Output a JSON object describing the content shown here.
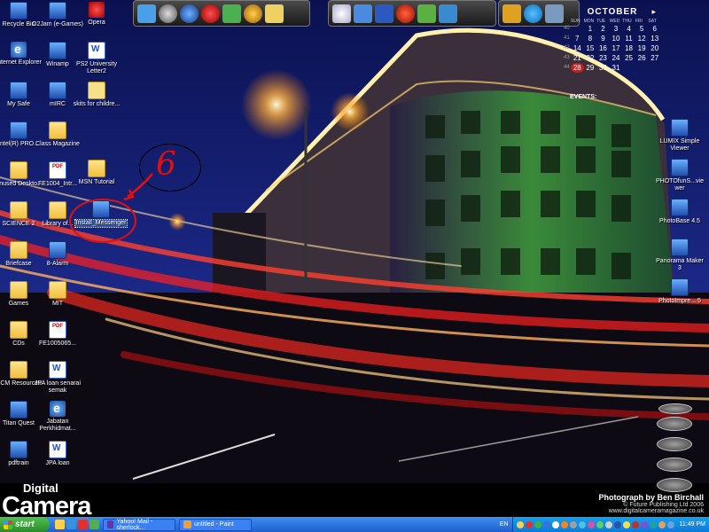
{
  "desktop": {
    "icons_left": [
      {
        "label": "Recycle Bin"
      },
      {
        "label": "Internet Explorer"
      },
      {
        "label": "My Safe"
      },
      {
        "label": "Intel(R) PRO..."
      },
      {
        "label": "Unused Deskto..."
      },
      {
        "label": "SCIENCE 2"
      },
      {
        "label": "Briefcase"
      },
      {
        "label": "Games"
      },
      {
        "label": "CDs"
      },
      {
        "label": "DCM Resources"
      },
      {
        "label": "Titan Quest"
      },
      {
        "label": "pdftrain"
      }
    ],
    "icons_col2": [
      {
        "label": "O2Jam (e-Games)"
      },
      {
        "label": "Winamp"
      },
      {
        "label": "mIRC"
      },
      {
        "label": "Class Magazine"
      },
      {
        "label": "FE1004_Intr..."
      },
      {
        "label": "Library of..."
      },
      {
        "label": "8-Alarm"
      },
      {
        "label": "MIT"
      },
      {
        "label": "FE1005065..."
      },
      {
        "label": "JPA loan senarai semak"
      },
      {
        "label": "Jabatan Perkhidmat..."
      },
      {
        "label": "JPA loan"
      }
    ],
    "icons_col3": [
      {
        "label": "Opera"
      },
      {
        "label": "PS2 University Letter2"
      },
      {
        "label": "skits for childre..."
      },
      {
        "label": "MSN Tutorial"
      }
    ],
    "selected_icon": {
      "label": "Install_Messenger"
    },
    "icons_right": [
      {
        "label": "LUMIX Simple Viewer"
      },
      {
        "label": "PHOTOfunS...viewer"
      },
      {
        "label": "PhotoBase 4.5"
      },
      {
        "label": "Panorama Maker 3"
      },
      {
        "label": "PhotoImpre... 5"
      }
    ]
  },
  "annotation": {
    "step_number": "6"
  },
  "calendar": {
    "month": "OCTOBER",
    "day_headers": [
      "SUN",
      "MON",
      "TUE",
      "WED",
      "THU",
      "FRI",
      "SAT"
    ],
    "weeks": [
      {
        "wk": "40",
        "days": [
          "",
          "1",
          "2",
          "3",
          "4",
          "5",
          "6"
        ]
      },
      {
        "wk": "41",
        "days": [
          "7",
          "8",
          "9",
          "10",
          "11",
          "12",
          "13"
        ]
      },
      {
        "wk": "42",
        "days": [
          "14",
          "15",
          "16",
          "17",
          "18",
          "19",
          "20"
        ]
      },
      {
        "wk": "43",
        "days": [
          "21",
          "22",
          "23",
          "24",
          "25",
          "26",
          "27"
        ]
      },
      {
        "wk": "44",
        "days": [
          "28",
          "29",
          "30",
          "31",
          "",
          "",
          ""
        ]
      }
    ],
    "today": "28",
    "events_label": "EVENTS:"
  },
  "branding": {
    "top": "Digital",
    "main": "Camera"
  },
  "credits": {
    "line1": "Photograph by Ben Birchall",
    "line2": "© Future Publishing Ltd 2006",
    "line3": "www.digitalcameramagazine.co.uk"
  },
  "taskbar": {
    "start_label": "start",
    "tasks": [
      {
        "label": "Yahoo! Mail - sherlock..."
      },
      {
        "label": "untitled - Paint"
      }
    ],
    "language": "EN",
    "clock": "11:49 PM"
  }
}
